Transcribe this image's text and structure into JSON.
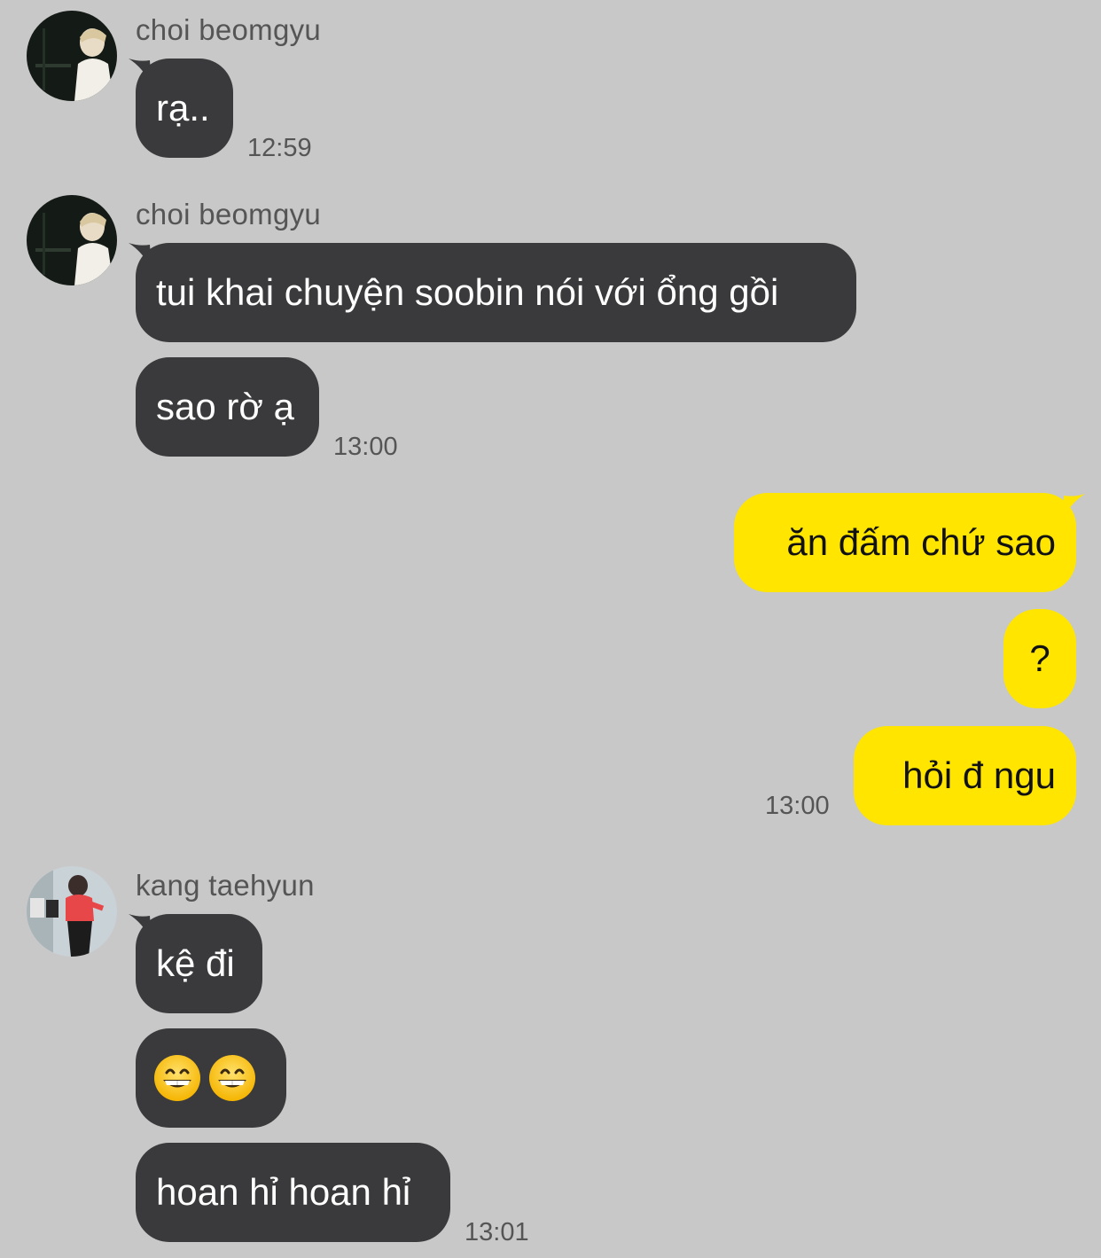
{
  "colors": {
    "background": "#c8c8c8",
    "incoming_bubble": "#3a3a3c",
    "outgoing_bubble": "#ffe500",
    "meta_text": "#555555"
  },
  "messages": [
    {
      "sender": "choi beomgyu",
      "avatar_icon": "profile-photo-beomgyu",
      "bubbles": [
        "rạ.."
      ],
      "time": "12:59"
    },
    {
      "sender": "choi beomgyu",
      "avatar_icon": "profile-photo-beomgyu",
      "bubbles": [
        "tui khai chuyện soobin nói với ổng gồi",
        "sao rờ ạ"
      ],
      "time": "13:00"
    },
    {
      "sender": "me",
      "bubbles": [
        "ăn đấm chứ sao",
        "?",
        "hỏi đ ngu"
      ],
      "time": "13:00"
    },
    {
      "sender": "kang taehyun",
      "avatar_icon": "profile-photo-taehyun",
      "bubbles": [
        "kệ đi",
        "grinning-face-emoji grinning-face-emoji",
        "hoan hỉ hoan hỉ"
      ],
      "time": "13:01"
    }
  ]
}
